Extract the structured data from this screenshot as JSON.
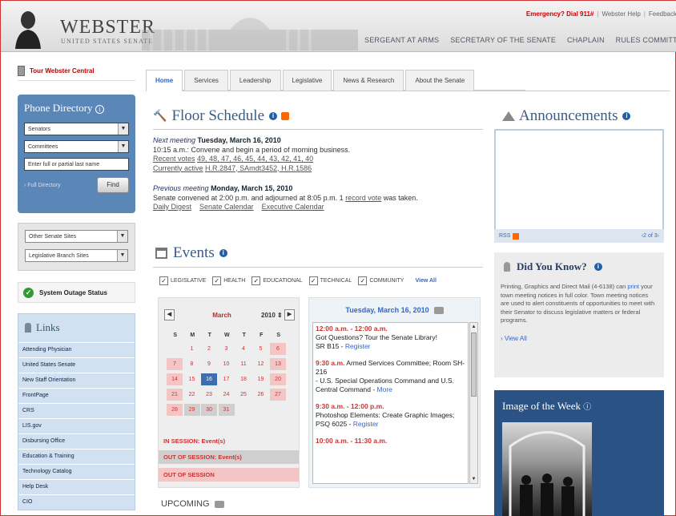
{
  "header": {
    "logo_title": "WEBSTER",
    "logo_subtitle": "UNITED STATES SENATE",
    "utility": {
      "emergency": "Emergency? Dial 911#",
      "help": "Webster Help",
      "feedback": "Feedback"
    },
    "nav": [
      "SERGEANT AT ARMS",
      "SECRETARY OF THE SENATE",
      "CHAPLAIN",
      "RULES COMMITTEE"
    ]
  },
  "sidebar": {
    "tour": "Tour Webster Central",
    "phone": {
      "title": "Phone Directory",
      "select1": "Senators",
      "select2": "Committees",
      "input_placeholder": "Enter full or partial last name",
      "full_directory": "› Full Directory",
      "find": "Find"
    },
    "sites": {
      "other": "Other Senate Sites",
      "legislative": "Legislative Branch Sites"
    },
    "outage": "System Outage Status",
    "links": {
      "title": "Links",
      "items": [
        "Attending Physician",
        "United States Senate",
        "New Staff Orientation",
        "FrontPage",
        "CRS",
        "LIS.gov",
        "Disbursing Office",
        "Education & Training",
        "Technology Catalog",
        "Help Desk",
        "CIO"
      ]
    }
  },
  "tabs": [
    "Home",
    "Services",
    "Leadership",
    "Legislative",
    "News & Research",
    "About the Senate"
  ],
  "floor": {
    "title": "Floor Schedule",
    "next_label": "Next meeting",
    "next_date": "Tuesday, March 16, 2010",
    "line1": "10:15 a.m.: Convene and begin a period of morning business.",
    "recent_votes_label": "Recent votes",
    "recent_votes": "49, 48, 47, 46, 45, 44, 43, 42, 41, 40",
    "active_label": "Currently active",
    "active": "H.R.2847, SAmdt3452, H.R.1586",
    "prev_label": "Previous meeting",
    "prev_date": "Monday, March 15, 2010",
    "prev_line_a": "Senate convened at 2:00 p.m. and adjourned at 8:05 p.m. 1",
    "prev_line_link": "record vote",
    "prev_line_b": "was taken.",
    "links": [
      "Daily Digest",
      "Senate Calendar",
      "Executive Calendar"
    ]
  },
  "events": {
    "title": "Events",
    "filters": [
      "LEGISLATIVE",
      "HEALTH",
      "EDUCATIONAL",
      "TECHNICAL",
      "COMMUNITY"
    ],
    "view_all": "View All",
    "calendar": {
      "month": "March",
      "year": "2010",
      "dow": [
        "S",
        "M",
        "T",
        "W",
        "T",
        "F",
        "S"
      ],
      "legend": [
        "IN SESSION: Event(s)",
        "OUT OF SESSION: Event(s)",
        "OUT OF SESSION"
      ]
    },
    "day_header": "Tuesday, March 16, 2010",
    "list": [
      {
        "time": "12:00 a.m. - 12:00 a.m.",
        "text": "Got Questions? Tour the Senate Library!",
        "where": "SR B15 - ",
        "link": "Register"
      },
      {
        "time": "9:30 a.m.",
        "text": "Armed Services Committee; Room SH-216",
        "where": "- U.S. Special Operations Command and U.S. Central Command - ",
        "link": "More"
      },
      {
        "time": "9:30 a.m. - 12:00 p.m.",
        "text": "Photoshop Elements: Create Graphic Images; PSQ 6025 - ",
        "where": "",
        "link": "Register"
      },
      {
        "time": "10:00 a.m. - 11:30 a.m.",
        "text": "",
        "where": "",
        "link": ""
      }
    ],
    "upcoming": "UPCOMING"
  },
  "announcements": {
    "title": "Announcements",
    "rss": "RSS",
    "pager": "‹2 of 3›"
  },
  "dyk": {
    "title": "Did You Know?",
    "text_a": "Printing, Graphics and Direct Mail (4-6138) can",
    "text_link": "print",
    "text_b": "your town meeting notices in full color. Town meeting notices are used to alert constituents of opportunities to meet with their Senator to discuss legislative matters or federal programs.",
    "view_all": "› View All"
  },
  "image_of_week": {
    "title": "Image of the Week"
  }
}
